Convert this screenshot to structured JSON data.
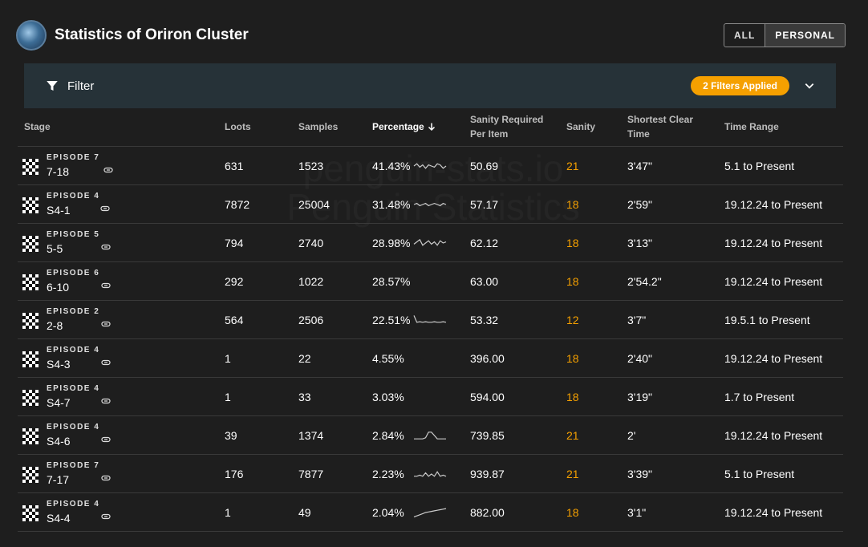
{
  "header": {
    "title": "Statistics of Oriron Cluster",
    "toggle": [
      "ALL",
      "PERSONAL"
    ],
    "toggle_active": "PERSONAL"
  },
  "filter": {
    "label": "Filter",
    "badge": "2 Filters Applied"
  },
  "watermark": [
    "penguin-stats.io",
    "Penguin Statistics"
  ],
  "table": {
    "headers": {
      "stage": "Stage",
      "loots": "Loots",
      "samples": "Samples",
      "percentage": "Percentage",
      "sanity_per_item_1": "Sanity Required",
      "sanity_per_item_2": "Per Item",
      "sanity": "Sanity",
      "clear_1": "Shortest Clear",
      "clear_2": "Time",
      "range": "Time Range"
    },
    "sort_icon": "arrow-down-icon",
    "accent_color": "#f5a000",
    "rows": [
      {
        "zone": "EPISODE 7",
        "code": "7-18",
        "loots": "631",
        "samples": "1523",
        "percentage": "41.43%",
        "spi": "50.69",
        "sanity": "21",
        "clear": "3'47\"",
        "range": "5.1 to Present",
        "trend": [
          0.5,
          0.7,
          0.4,
          0.6,
          0.3,
          0.6,
          0.5,
          0.4,
          0.7,
          0.6,
          0.3,
          0.5
        ]
      },
      {
        "zone": "EPISODE 4",
        "code": "S4-1",
        "loots": "7872",
        "samples": "25004",
        "percentage": "31.48%",
        "spi": "57.17",
        "sanity": "18",
        "clear": "2'59\"",
        "range": "19.12.24 to Present",
        "trend": [
          0.5,
          0.6,
          0.4,
          0.5,
          0.6,
          0.4,
          0.5,
          0.6,
          0.5,
          0.4,
          0.6,
          0.5
        ]
      },
      {
        "zone": "EPISODE 5",
        "code": "5-5",
        "loots": "794",
        "samples": "2740",
        "percentage": "28.98%",
        "spi": "62.12",
        "sanity": "18",
        "clear": "3'13\"",
        "range": "19.12.24 to Present",
        "trend": [
          0.4,
          0.6,
          0.8,
          0.3,
          0.5,
          0.7,
          0.4,
          0.6,
          0.3,
          0.7,
          0.5,
          0.6
        ]
      },
      {
        "zone": "EPISODE 6",
        "code": "6-10",
        "loots": "292",
        "samples": "1022",
        "percentage": "28.57%",
        "spi": "63.00",
        "sanity": "18",
        "clear": "2'54.2\"",
        "range": "19.12.24 to Present",
        "trend": []
      },
      {
        "zone": "EPISODE 2",
        "code": "2-8",
        "loots": "564",
        "samples": "2506",
        "percentage": "22.51%",
        "spi": "53.32",
        "sanity": "12",
        "clear": "3'7\"",
        "range": "19.5.1 to Present",
        "trend": [
          0.9,
          0.3,
          0.35,
          0.3,
          0.35,
          0.3,
          0.3,
          0.35,
          0.3,
          0.3,
          0.35,
          0.3
        ]
      },
      {
        "zone": "EPISODE 4",
        "code": "S4-3",
        "loots": "1",
        "samples": "22",
        "percentage": "4.55%",
        "spi": "396.00",
        "sanity": "18",
        "clear": "2'40\"",
        "range": "19.12.24 to Present",
        "trend": []
      },
      {
        "zone": "EPISODE 4",
        "code": "S4-7",
        "loots": "1",
        "samples": "33",
        "percentage": "3.03%",
        "spi": "594.00",
        "sanity": "18",
        "clear": "3'19\"",
        "range": "1.7 to Present",
        "trend": []
      },
      {
        "zone": "EPISODE 4",
        "code": "S4-6",
        "loots": "39",
        "samples": "1374",
        "percentage": "2.84%",
        "spi": "739.85",
        "sanity": "21",
        "clear": "2'",
        "range": "19.12.24 to Present",
        "trend": [
          0.2,
          0.2,
          0.2,
          0.2,
          0.3,
          0.8,
          0.8,
          0.5,
          0.2,
          0.2,
          0.2,
          0.2
        ]
      },
      {
        "zone": "EPISODE 7",
        "code": "7-17",
        "loots": "176",
        "samples": "7877",
        "percentage": "2.23%",
        "spi": "939.87",
        "sanity": "21",
        "clear": "3'39\"",
        "range": "5.1 to Present",
        "trend": [
          0.3,
          0.3,
          0.4,
          0.3,
          0.6,
          0.3,
          0.5,
          0.3,
          0.7,
          0.3,
          0.4,
          0.3
        ]
      },
      {
        "zone": "EPISODE 4",
        "code": "S4-4",
        "loots": "1",
        "samples": "49",
        "percentage": "2.04%",
        "spi": "882.00",
        "sanity": "18",
        "clear": "3'1\"",
        "range": "19.12.24 to Present",
        "trend": [
          0.1,
          0.2,
          0.3,
          0.4,
          0.5,
          0.55,
          0.6,
          0.65,
          0.7,
          0.75,
          0.8,
          0.85
        ]
      }
    ]
  }
}
